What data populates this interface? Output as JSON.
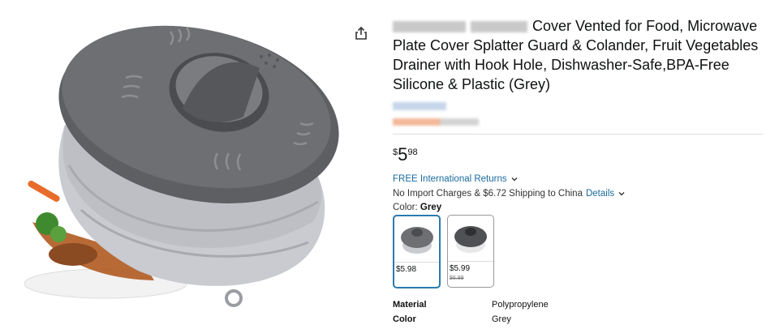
{
  "product": {
    "title_text": "Cover Vented for Food, Microwave Plate Cover Splatter Guard & Colander, Fruit Vegetables Drainer with Hook Hole, Dishwasher-Safe,BPA-Free Silicone & Plastic (Grey)",
    "price": {
      "currency": "$",
      "whole": "5",
      "fraction": "98"
    },
    "returns_link": "FREE International Returns",
    "shipping_text": "No Import Charges & $6.72 Shipping to China",
    "details_link": "Details",
    "color_label": "Color:",
    "color_value": "Grey"
  },
  "swatches": [
    {
      "price": "$5.98",
      "selected": true
    },
    {
      "price": "$5.99",
      "old_price": "$6.99",
      "selected": false
    }
  ],
  "specs": [
    {
      "key": "Material",
      "value": "Polypropylene"
    },
    {
      "key": "Color",
      "value": "Grey"
    }
  ],
  "icons": [
    "share-icon",
    "chevron-down-icon"
  ],
  "colors": {
    "link": "#1a6b9c",
    "selected_border": "#2a7ab0",
    "lid": "#6b6d70",
    "bowl": "#c9cbd0"
  }
}
